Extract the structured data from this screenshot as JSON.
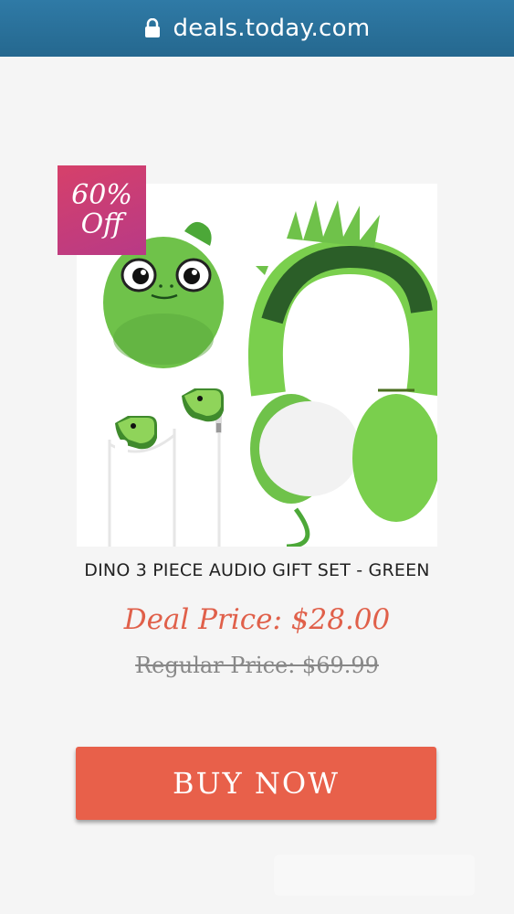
{
  "browser": {
    "url": "deals.today.com"
  },
  "badge": {
    "percent": "60%",
    "label": "Off"
  },
  "product": {
    "title": "DINO 3 PIECE AUDIO GIFT SET - GREEN",
    "deal_price": "Deal Price: $28.00",
    "regular_price": "Regular Price: $69.99"
  },
  "cta": {
    "label": "BUY NOW"
  },
  "colors": {
    "url_bar": "#2f7aa6",
    "badge": "#c83d78",
    "deal_price": "#e0604a",
    "buy_button": "#e8604a",
    "dino_green": "#6fc24a"
  }
}
